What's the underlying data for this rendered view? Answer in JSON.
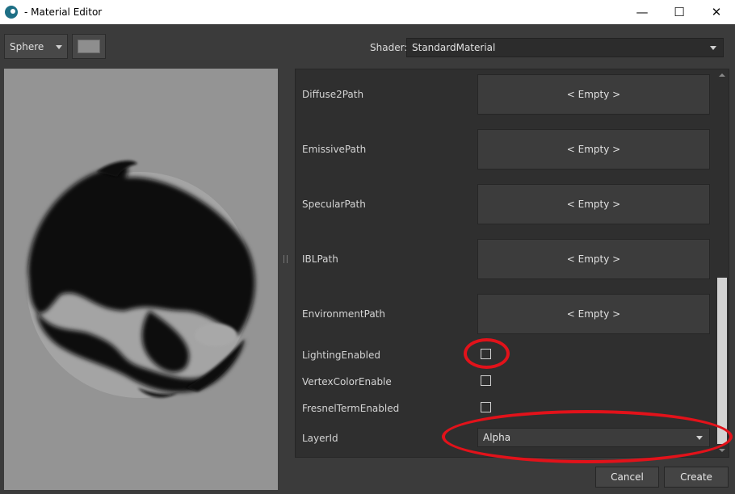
{
  "window": {
    "title": "- Material Editor",
    "minimize_glyph": "—",
    "maximize_glyph": "☐",
    "close_glyph": "✕"
  },
  "toolbar": {
    "preview_shape": "Sphere",
    "shader_label": "Shader:",
    "shader_value": "StandardMaterial"
  },
  "properties": {
    "paths": [
      {
        "label": "Diffuse2Path",
        "value": "< Empty >"
      },
      {
        "label": "EmissivePath",
        "value": "< Empty >"
      },
      {
        "label": "SpecularPath",
        "value": "< Empty >"
      },
      {
        "label": "IBLPath",
        "value": "< Empty >"
      },
      {
        "label": "EnvironmentPath",
        "value": "< Empty >"
      }
    ],
    "checkboxes": [
      {
        "label": "LightingEnabled",
        "checked": false
      },
      {
        "label": "VertexColorEnable",
        "checked": false
      },
      {
        "label": "FresnelTermEnabled",
        "checked": false
      }
    ],
    "layer": {
      "label": "LayerId",
      "value": "Alpha"
    }
  },
  "buttons": {
    "cancel": "Cancel",
    "create": "Create"
  },
  "colors": {
    "annotation": "#e2121a",
    "background": "#3b3b3b",
    "panel": "#2f2f2f",
    "preview_bg": "#949494"
  }
}
